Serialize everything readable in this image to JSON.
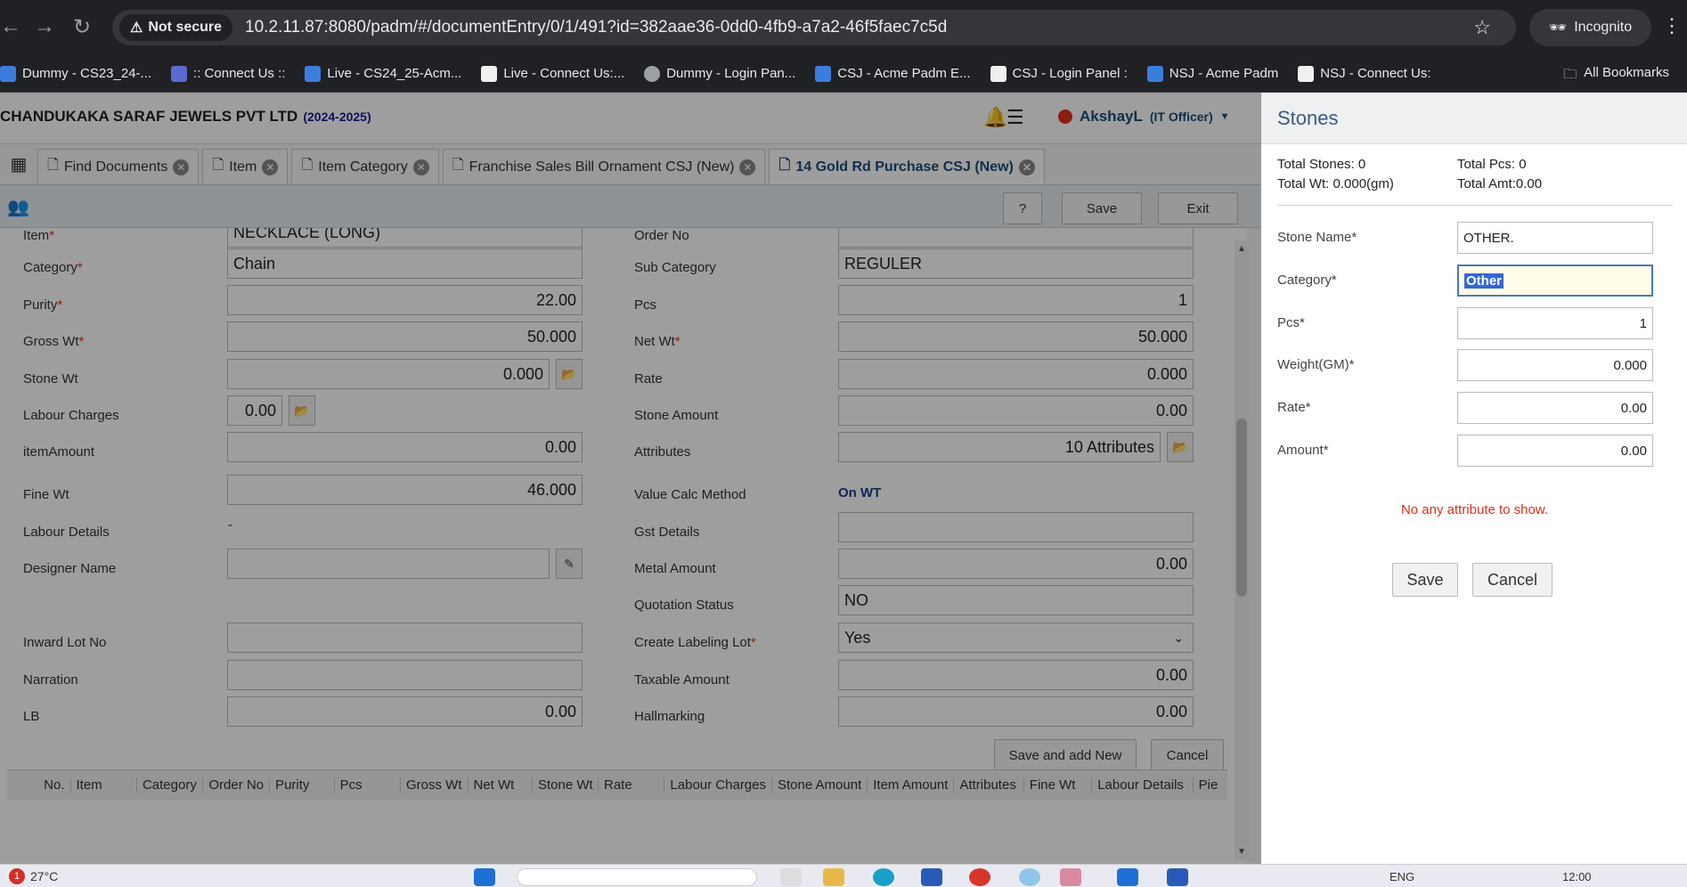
{
  "browser": {
    "not_secure": "Not secure",
    "url": "10.2.11.87:8080/padm/#/documentEntry/0/1/491?id=382aae36-0dd0-4fb9-a7a2-46f5faec7c5d",
    "incognito": "Incognito",
    "bookmarks": [
      "Dummy - CS23_24-...",
      ":: Connect Us ::",
      "Live - CS24_25-Acm...",
      "Live - Connect Us:...",
      "Dummy - Login Pan...",
      "CSJ - Acme Padm E...",
      "CSJ - Login Panel :",
      "NSJ - Acme Padm",
      "NSJ - Connect Us:"
    ],
    "all_bookmarks": "All Bookmarks"
  },
  "header": {
    "company": "CHANDUKAKA SARAF JEWELS PVT LTD",
    "year": "(2024-2025)",
    "user": "AkshayL",
    "role": "(IT Officer)"
  },
  "tabs": [
    "Find Documents",
    "Item",
    "Item Category",
    "Franchise Sales Bill Ornament CSJ (New)",
    "14 Gold Rd Purchase CSJ (New)"
  ],
  "toolbar": {
    "save": "Save",
    "exit": "Exit"
  },
  "form": {
    "item_label": "Item",
    "item_value": "NECKLACE (LONG)",
    "category_label": "Category",
    "category_value": "Chain",
    "purity_label": "Purity",
    "purity_value": "22.00",
    "gross_wt_label": "Gross Wt",
    "gross_wt_value": "50.000",
    "stone_wt_label": "Stone Wt",
    "stone_wt_value": "0.000",
    "labour_charges_label": "Labour Charges",
    "labour_charges_value": "0.00",
    "item_amount_label": "itemAmount",
    "item_amount_value": "0.00",
    "fine_wt_label": "Fine Wt",
    "fine_wt_value": "46.000",
    "labour_details_label": "Labour Details",
    "labour_details_value": "-",
    "designer_name_label": "Designer Name",
    "inward_lot_label": "Inward Lot No",
    "narration_label": "Narration",
    "lb_label": "LB",
    "lb_value": "0.00",
    "order_no_label": "Order No",
    "sub_category_label": "Sub Category",
    "sub_category_value": "REGULER",
    "pcs_label": "Pcs",
    "pcs_value": "1",
    "net_wt_label": "Net Wt",
    "net_wt_value": "50.000",
    "rate_label": "Rate",
    "rate_value": "0.000",
    "stone_amount_label": "Stone Amount",
    "stone_amount_value": "0.00",
    "attributes_label": "Attributes",
    "attributes_value": "10 Attributes",
    "value_calc_label": "Value Calc Method",
    "value_calc_value": "On WT",
    "gst_details_label": "Gst Details",
    "metal_amount_label": "Metal Amount",
    "metal_amount_value": "0.00",
    "quotation_status_label": "Quotation Status",
    "quotation_status_value": "NO",
    "labeling_lot_label": "Create Labeling Lot",
    "labeling_lot_value": "Yes",
    "taxable_amount_label": "Taxable Amount",
    "taxable_amount_value": "0.00",
    "hallmarking_label": "Hallmarking",
    "hallmarking_value": "0.00",
    "save_add_new": "Save and add New",
    "cancel": "Cancel"
  },
  "grid_headers": [
    "No.",
    "Item",
    "Category",
    "Order No",
    "Purity",
    "Pcs",
    "Gross Wt",
    "Net Wt",
    "Stone Wt",
    "Rate",
    "Labour Charges",
    "Stone Amount",
    "Item Amount",
    "Attributes",
    "Fine Wt",
    "Labour Details",
    "Pie"
  ],
  "stones": {
    "title": "Stones",
    "total_stones": "Total Stones: 0",
    "total_pcs": "Total Pcs: 0",
    "total_wt": "Total Wt: 0.000(gm)",
    "total_amt": "Total Amt:0.00",
    "stone_name_label": "Stone Name*",
    "stone_name_value": "OTHER.",
    "category_label": "Category*",
    "category_value": "Other",
    "pcs_label": "Pcs*",
    "pcs_value": "1",
    "weight_label": "Weight(GM)*",
    "weight_value": "0.000",
    "rate_label": "Rate*",
    "rate_value": "0.00",
    "amount_label": "Amount*",
    "amount_value": "0.00",
    "no_attr": "No any attribute to show.",
    "save": "Save",
    "cancel": "Cancel"
  },
  "taskbar": {
    "weather": "27°C",
    "badge": "1",
    "lang": "ENG",
    "time": "12:00"
  },
  "colors": {
    "accent": "#1a4c7a",
    "required": "#e0301e",
    "chrome": "#202124"
  }
}
